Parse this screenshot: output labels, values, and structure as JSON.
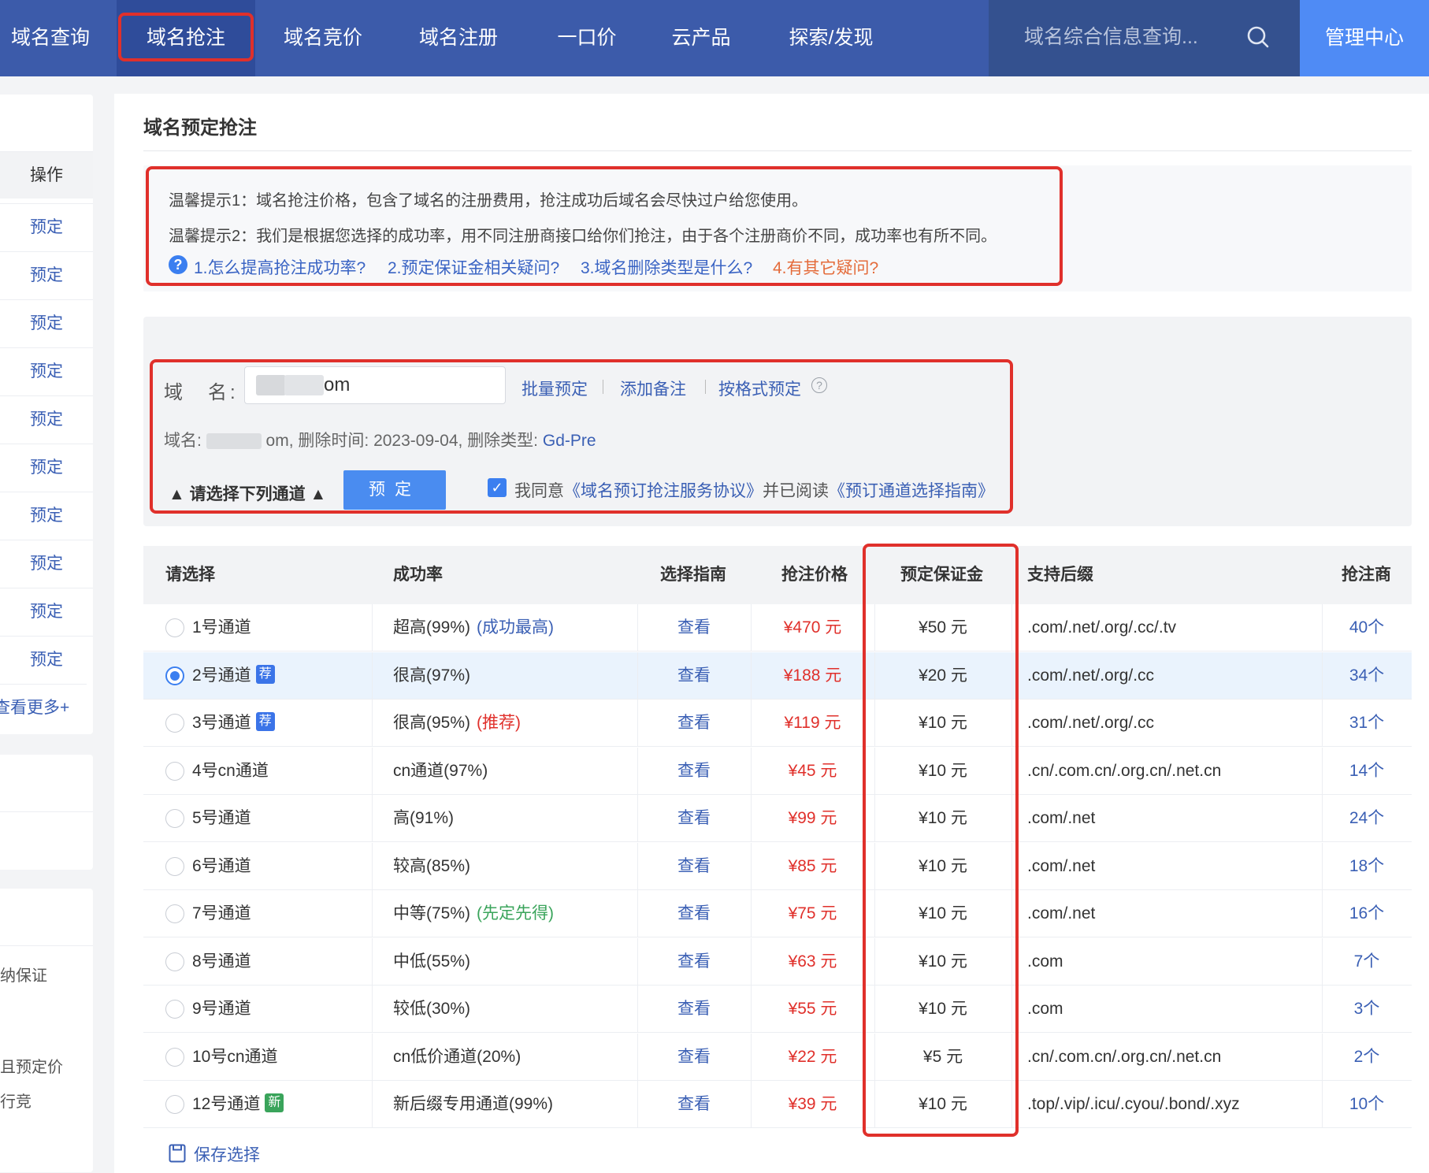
{
  "nav": {
    "items": [
      "域名查询",
      "域名抢注",
      "域名竞价",
      "域名注册",
      "一口价",
      "云产品",
      "探索/发现"
    ],
    "search_placeholder": "域名综合信息查询...",
    "admin": "管理中心"
  },
  "sidebar": {
    "header": "操作",
    "actions": [
      "预定",
      "预定",
      "预定",
      "预定",
      "预定",
      "预定",
      "预定",
      "预定",
      "预定",
      "预定"
    ],
    "more": "查看更多+",
    "fragments": [
      "纳保证",
      "且预定价",
      "行竞"
    ]
  },
  "page": {
    "title": "域名预定抢注",
    "tip1": "温馨提示1：域名抢注价格，包含了域名的注册费用，抢注成功后域名会尽快过户给您使用。",
    "tip2": "温馨提示2：我们是根据您选择的成功率，用不同注册商接口给你们抢注，由于各个注册商价不同，成功率也有所不同。",
    "faq": [
      "1.怎么提高抢注成功率?",
      "2.预定保证金相关疑问?",
      "3.域名删除类型是什么?",
      "4.有其它疑问?"
    ]
  },
  "form": {
    "label": "域　名:",
    "input_value": "om",
    "links": [
      "批量预定",
      "添加备注",
      "按格式预定"
    ],
    "info_prefix": "域名:",
    "info_domain_tail": "om,",
    "info_delete_label": "删除时间:",
    "info_delete_date": "2023-09-04,",
    "info_type_label": "删除类型:",
    "info_type": "Gd-Pre",
    "channel_toggle": "▲ 请选择下列通道 ▲",
    "submit": "预定",
    "agree_prefix": "我同意",
    "agree_link1": "《域名预订抢注服务协议》",
    "agree_mid": "并已阅读",
    "agree_link2": "《预订通道选择指南》"
  },
  "table": {
    "headers": [
      "请选择",
      "成功率",
      "选择指南",
      "抢注价格",
      "预定保证金",
      "支持后缀",
      "抢注商"
    ],
    "rows": [
      {
        "name": "1号通道",
        "badge": "",
        "rate": "超高(99%)",
        "note": "(成功最高)",
        "guide": "查看",
        "price": "¥470 元",
        "deposit": "¥50 元",
        "suffix": ".com/.net/.org/.cc/.tv",
        "count": "40个"
      },
      {
        "name": "2号通道",
        "badge": "荐",
        "rate": "很高(97%)",
        "note": "",
        "guide": "查看",
        "price": "¥188 元",
        "deposit": "¥20 元",
        "suffix": ".com/.net/.org/.cc",
        "count": "34个"
      },
      {
        "name": "3号通道",
        "badge": "荐",
        "rate": "很高(95%)",
        "note": "(推荐)",
        "guide": "查看",
        "price": "¥119 元",
        "deposit": "¥10 元",
        "suffix": ".com/.net/.org/.cc",
        "count": "31个"
      },
      {
        "name": "4号cn通道",
        "badge": "",
        "rate": "cn通道(97%)",
        "note": "",
        "guide": "查看",
        "price": "¥45 元",
        "deposit": "¥10 元",
        "suffix": ".cn/.com.cn/.org.cn/.net.cn",
        "count": "14个"
      },
      {
        "name": "5号通道",
        "badge": "",
        "rate": "高(91%)",
        "note": "",
        "guide": "查看",
        "price": "¥99 元",
        "deposit": "¥10 元",
        "suffix": ".com/.net",
        "count": "24个"
      },
      {
        "name": "6号通道",
        "badge": "",
        "rate": "较高(85%)",
        "note": "",
        "guide": "查看",
        "price": "¥85 元",
        "deposit": "¥10 元",
        "suffix": ".com/.net",
        "count": "18个"
      },
      {
        "name": "7号通道",
        "badge": "",
        "rate": "中等(75%)",
        "note": "(先定先得)",
        "guide": "查看",
        "price": "¥75 元",
        "deposit": "¥10 元",
        "suffix": ".com/.net",
        "count": "16个"
      },
      {
        "name": "8号通道",
        "badge": "",
        "rate": "中低(55%)",
        "note": "",
        "guide": "查看",
        "price": "¥63 元",
        "deposit": "¥10 元",
        "suffix": ".com",
        "count": "7个"
      },
      {
        "name": "9号通道",
        "badge": "",
        "rate": "较低(30%)",
        "note": "",
        "guide": "查看",
        "price": "¥55 元",
        "deposit": "¥10 元",
        "suffix": ".com",
        "count": "3个"
      },
      {
        "name": "10号cn通道",
        "badge": "",
        "rate": "cn低价通道(20%)",
        "note": "",
        "guide": "查看",
        "price": "¥22 元",
        "deposit": "¥5 元",
        "suffix": ".cn/.com.cn/.org.cn/.net.cn",
        "count": "2个"
      },
      {
        "name": "12号通道",
        "badge": "新",
        "rate": "新后缀专用通道(99%)",
        "note": "",
        "guide": "查看",
        "price": "¥39 元",
        "deposit": "¥10 元",
        "suffix": ".top/.vip/.icu/.cyou/.bond/.xyz",
        "count": "10个"
      }
    ],
    "selected_index": 1,
    "save": "保存选择"
  }
}
